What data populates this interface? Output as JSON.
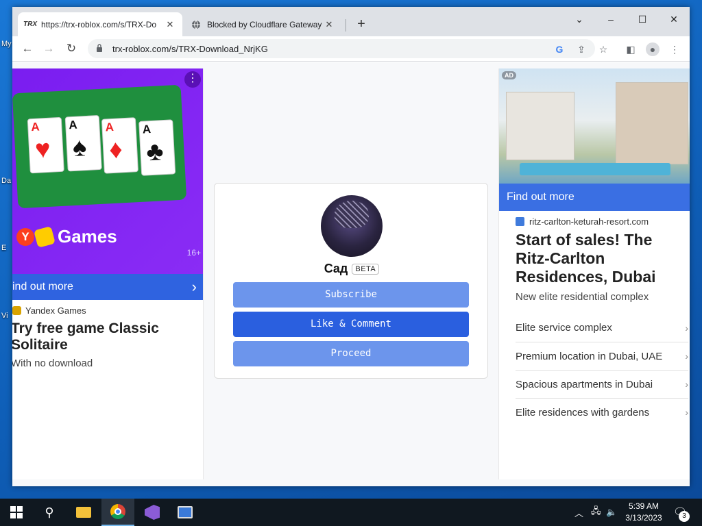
{
  "desktop": {
    "labels": [
      "My",
      "Da",
      "E",
      "Vi"
    ]
  },
  "browser": {
    "tabs": [
      {
        "title": "https://trx-roblox.com/s/TRX-Do",
        "favicon": "TRX",
        "active": true
      },
      {
        "title": "Blocked by Cloudflare Gateway",
        "favicon": "globe-icon",
        "active": false
      }
    ],
    "new_tab": "+",
    "window_controls": {
      "tab_search": "⌄",
      "minimize": "–",
      "maximize": "☐",
      "close": "✕"
    },
    "nav": {
      "back": "←",
      "forward": "→",
      "reload": "↻"
    },
    "url": "trx-roblox.com/s/TRX-Download_NrjKG",
    "omnibox_icons": {
      "google": "G",
      "share": "⇪",
      "bookmark": "☆",
      "side_panel": "◧",
      "profile": "●",
      "menu": "⋮"
    }
  },
  "left_ad": {
    "brand": "Games",
    "brand_letter": "Y",
    "age_rating": "16+",
    "menu_dots": "⋮",
    "cards": [
      {
        "rank": "A",
        "suit": "♥",
        "color": "red"
      },
      {
        "rank": "A",
        "suit": "♠",
        "color": "blk"
      },
      {
        "rank": "A",
        "suit": "♦",
        "color": "red"
      },
      {
        "rank": "A",
        "suit": "♣",
        "color": "blk"
      }
    ],
    "find_more": "ind out more",
    "find_more_chevron": "›",
    "source": "Yandex Games",
    "title": "Try free game Classic Solitaire",
    "subtitle": "With no download"
  },
  "profile": {
    "name": "Сад",
    "badge": "BETA",
    "buttons": {
      "subscribe": "Subscribe",
      "like": "Like & Comment",
      "proceed": "Proceed"
    }
  },
  "right_ad": {
    "badge": "AD",
    "find_more": "Find out more",
    "source": "ritz-carlton-keturah-resort.com",
    "title": "Start of sales! The Ritz-Carlton Residences, Dubai",
    "subtitle": "New elite residential complex",
    "features": [
      "Elite service complex",
      "Premium location in Dubai, UAE",
      "Spacious apartments in Dubai",
      "Elite residences with gardens"
    ],
    "chevron": "›"
  },
  "taskbar": {
    "search_icon": "⚲",
    "tray_chevron": "︿",
    "network": "🖧",
    "volume": "🔈",
    "time": "5:39 AM",
    "date": "3/13/2023",
    "notification_count": "3",
    "notification_icon": "🗨"
  }
}
